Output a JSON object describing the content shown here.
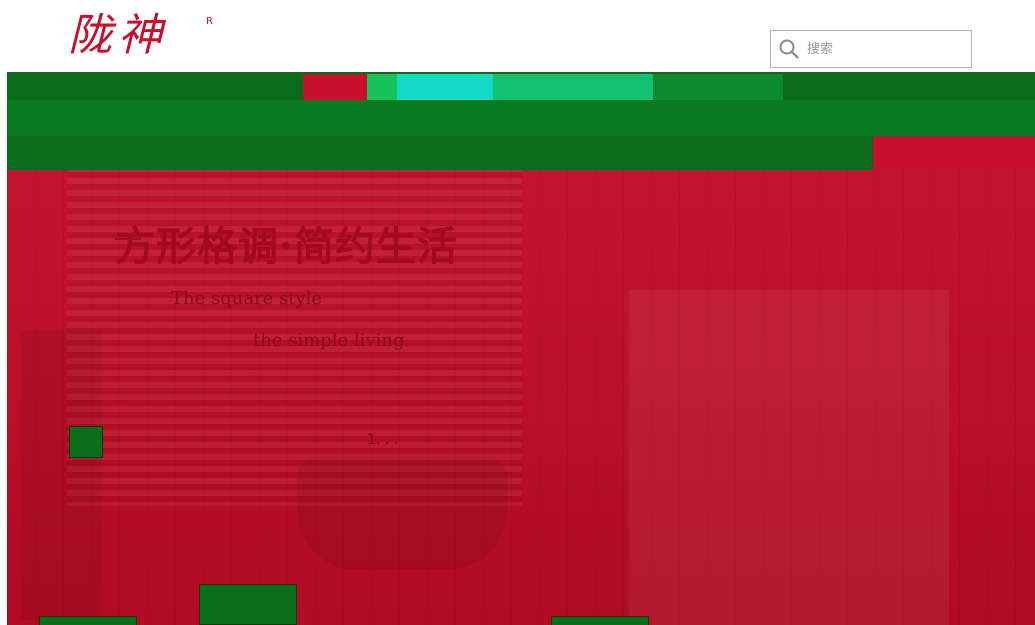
{
  "brand": {
    "logo_text": "陇神",
    "registered_mark": "R"
  },
  "search": {
    "placeholder": "搜索",
    "icon": "search-icon"
  },
  "nav": {
    "items": [
      "",
      "",
      "",
      "",
      ""
    ]
  },
  "hero": {
    "title": "方形格调·简约生活",
    "subtitle_line1": "The square style",
    "subtitle_line2": "the simple living",
    "dots": "1. . ."
  },
  "colors": {
    "brand_red": "#c8102e",
    "nav_green": "#0a6b1a",
    "hero_bg": "#c00b25"
  }
}
